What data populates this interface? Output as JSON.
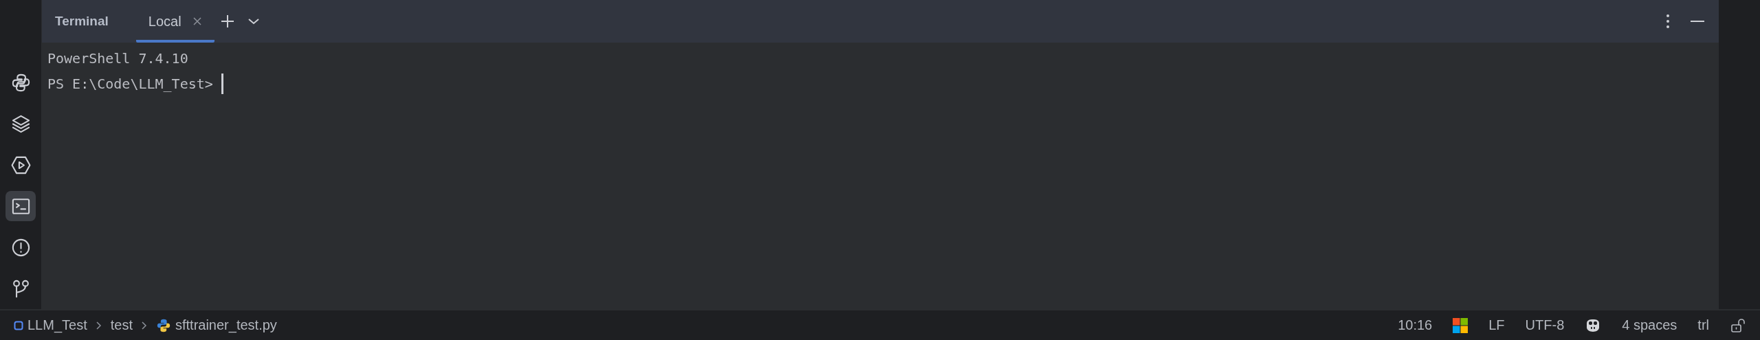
{
  "tool_window": {
    "title": "Terminal",
    "tabs": [
      {
        "label": "Local",
        "selected": true
      }
    ]
  },
  "terminal": {
    "lines": [
      {
        "text": "PowerShell 7.4.10",
        "cursor": false
      },
      {
        "text": "PS E:\\Code\\LLM_Test> ",
        "cursor": true
      }
    ]
  },
  "sidebar": {
    "items": [
      {
        "kind": "python",
        "selected": false
      },
      {
        "kind": "layers",
        "selected": false
      },
      {
        "kind": "services",
        "selected": false
      },
      {
        "kind": "terminal",
        "selected": true
      },
      {
        "kind": "problems",
        "selected": false
      },
      {
        "kind": "git",
        "selected": false
      }
    ]
  },
  "breadcrumbs": [
    {
      "kind": "project",
      "label": "LLM_Test"
    },
    {
      "kind": "folder",
      "label": "test"
    },
    {
      "kind": "python",
      "label": "sfttrainer_test.py"
    }
  ],
  "status_bar": [
    {
      "kind": "text",
      "label": "10:16"
    },
    {
      "kind": "windows"
    },
    {
      "kind": "text",
      "label": "LF"
    },
    {
      "kind": "text",
      "label": "UTF-8"
    },
    {
      "kind": "copilot"
    },
    {
      "kind": "text",
      "label": "4 spaces"
    },
    {
      "kind": "text",
      "label": "trl"
    },
    {
      "kind": "lock"
    }
  ]
}
